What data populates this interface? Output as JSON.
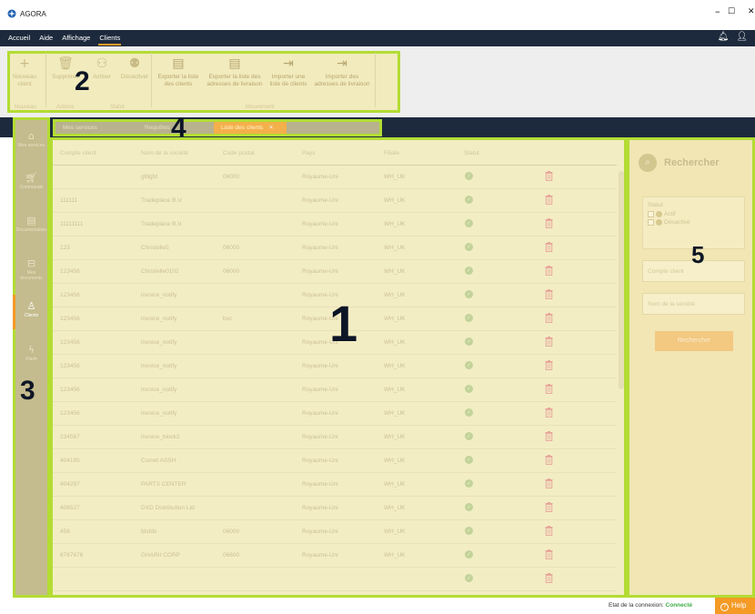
{
  "window": {
    "title": "AGORA"
  },
  "menu": {
    "items": [
      "Accueil",
      "Aide",
      "Affichage",
      "Clients"
    ],
    "active": "Clients"
  },
  "ribbon": {
    "buttons": [
      {
        "label": "Nouveau client",
        "icon": "plus-icon"
      },
      {
        "label": "Supprimer",
        "icon": "trash-icon"
      },
      {
        "label": "Activer",
        "icon": "user-check-icon"
      },
      {
        "label": "Désactiver",
        "icon": "user-off-icon"
      },
      {
        "label": "Exporter la liste des clients",
        "icon": "export-excel-icon"
      },
      {
        "label": "Exporter la liste des adresses de livraison",
        "icon": "export-excel-icon"
      },
      {
        "label": "Importer une liste de clients",
        "icon": "import-icon"
      },
      {
        "label": "Importer des adresses de livraison",
        "icon": "import-icon"
      }
    ],
    "groups": [
      "Nouveau",
      "Actions",
      "Statut",
      "Mouvement"
    ]
  },
  "sidebar": {
    "items": [
      {
        "label": "Mes services",
        "icon": "home-icon"
      },
      {
        "label": "Commande",
        "icon": "cart-icon"
      },
      {
        "label": "Documentation",
        "icon": "document-icon"
      },
      {
        "label": "Mes documents",
        "icon": "inbox-icon"
      },
      {
        "label": "Clients",
        "icon": "user-icon"
      },
      {
        "label": "Flash",
        "icon": "flash-icon"
      }
    ],
    "active": "Clients"
  },
  "tabs": [
    {
      "label": "Mes services",
      "closable": false
    },
    {
      "label": "Requêtes",
      "closable": true
    },
    {
      "label": "Liste des clients",
      "closable": true
    }
  ],
  "table": {
    "columns": [
      "Compte client",
      "Nom de la société",
      "Code postal",
      "Pays",
      "Filiale",
      "Statut"
    ],
    "rows": [
      [
        "",
        "gfdgfd",
        "06000",
        "Royaume-Uni",
        "WH_UK"
      ],
      [
        "111111",
        "Tradeplace B.V.",
        "",
        "Royaume-Uni",
        "WH_UK"
      ],
      [
        "11111111",
        "Tradeplace B.V.",
        "",
        "Royaume-Uni",
        "WH_UK"
      ],
      [
        "123",
        "Christelle5",
        "06000",
        "Royaume-Uni",
        "WH_UK"
      ],
      [
        "123456",
        "Christelle0102",
        "06000",
        "Royaume-Uni",
        "WH_UK"
      ],
      [
        "123456",
        "invoice_notify",
        "",
        "Royaume-Uni",
        "WH_UK"
      ],
      [
        "123456",
        "invoice_notify",
        "bvc",
        "Royaume-Uni",
        "WH_UK"
      ],
      [
        "123456",
        "invoice_notify",
        "",
        "Royaume-Uni",
        "WH_UK"
      ],
      [
        "123456",
        "invoice_notify",
        "",
        "Royaume-Uni",
        "WH_UK"
      ],
      [
        "123456",
        "invoice_notify",
        "",
        "Royaume-Uni",
        "WH_UK"
      ],
      [
        "123456",
        "invoice_notify",
        "",
        "Royaume-Uni",
        "WH_UK"
      ],
      [
        "234567",
        "invoice_block2",
        "",
        "Royaume-Uni",
        "WH_UK"
      ],
      [
        "404195",
        "Comet ASSH",
        "",
        "Royaume-Uni",
        "WH_UK"
      ],
      [
        "404297",
        "PARTS CENTER",
        "",
        "Royaume-Uni",
        "WH_UK"
      ],
      [
        "406527",
        "DXD Distribution Ltd",
        "",
        "Royaume-Uni",
        "WH_UK"
      ],
      [
        "456",
        "fdsfds",
        "06000",
        "Royaume-Uni",
        "WH_UK"
      ],
      [
        "6767676",
        "GHARII CORP",
        "06600",
        "Royaume-Uni",
        "WH_UK"
      ],
      [
        "",
        "",
        "",
        "",
        ""
      ]
    ]
  },
  "search": {
    "title": "Rechercher",
    "status_label": "Statut",
    "options": [
      "Actif",
      "Désactivé"
    ],
    "client_placeholder": "Compte client",
    "company_placeholder": "Nom de la société",
    "button": "Rechercher"
  },
  "annotations": [
    "1",
    "2",
    "3",
    "4",
    "5"
  ],
  "statusbar": {
    "label": "Etat de la connexion:",
    "value": "Connecté",
    "help": "Help"
  },
  "colors": {
    "highlight_border": "#b3dc34",
    "accent": "#f49a25",
    "navbar": "#1d2a3d"
  }
}
